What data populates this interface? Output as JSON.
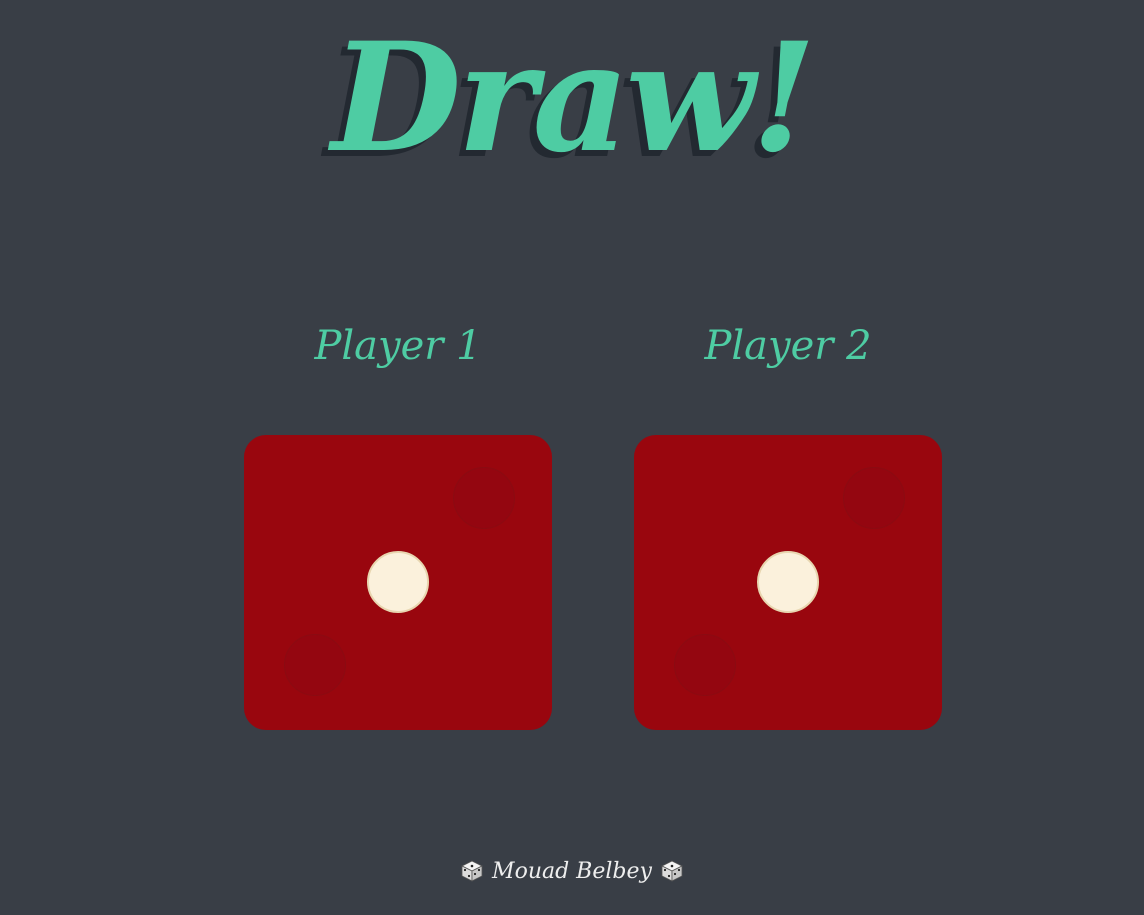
{
  "header": {
    "title": "Draw!"
  },
  "players": [
    {
      "label": "Player 1",
      "die_value": 1
    },
    {
      "label": "Player 2",
      "die_value": 1
    }
  ],
  "footer": {
    "author": "Mouad Belbey",
    "left_icon": "dice-icon",
    "right_icon": "dice-icon"
  },
  "colors": {
    "background": "#393e46",
    "accent": "#4ecca3",
    "die": "#99060e",
    "pip": "#fbf1dc"
  }
}
